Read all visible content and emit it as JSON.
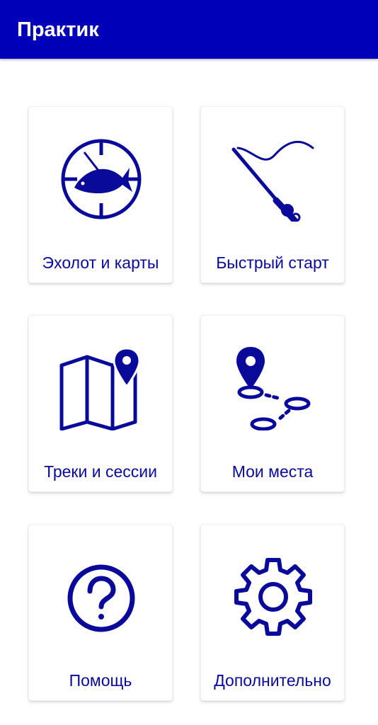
{
  "appbar": {
    "title": "Практик",
    "color": "#0000b8"
  },
  "tiles": [
    {
      "label": "Эхолот и карты",
      "icon": "fish-crosshair-icon"
    },
    {
      "label": "Быстрый старт",
      "icon": "fishing-rod-icon"
    },
    {
      "label": "Треки и сессии",
      "icon": "map-pin-icon"
    },
    {
      "label": "Мои места",
      "icon": "route-waypoints-icon"
    },
    {
      "label": "Помощь",
      "icon": "help-question-icon"
    },
    {
      "label": "Дополнительно",
      "icon": "gear-icon"
    }
  ],
  "accent_color": "#0a0a9a"
}
